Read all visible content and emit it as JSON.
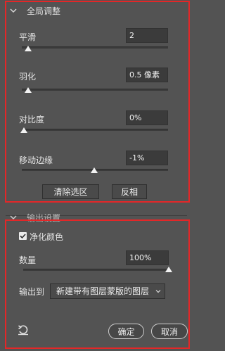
{
  "global_adjust": {
    "title": "全局调整",
    "smooth": {
      "label": "平滑",
      "value": "2",
      "level": 0.03
    },
    "feather": {
      "label": "羽化",
      "value": "0.5 像素",
      "level": 0.03
    },
    "contrast": {
      "label": "对比度",
      "value": "0%",
      "level": 0.0
    },
    "shift_edge": {
      "label": "移动边缘",
      "value": "-1%",
      "level": 0.49
    },
    "clear_selection_label": "清除选区",
    "invert_label": "反相"
  },
  "output": {
    "title": "输出设置",
    "decontaminate_label": "净化颜色",
    "decontaminate_checked": true,
    "amount": {
      "label": "数量",
      "value": "100%",
      "level": 1.0
    },
    "output_to_label": "输出到",
    "output_to_value": "新建带有图层蒙版的图层"
  },
  "footer": {
    "ok_label": "确定",
    "cancel_label": "取消"
  },
  "icons": {
    "collapse": "chevron-down-icon",
    "reset": "reset-icon",
    "check": "checkmark-icon",
    "dropdown": "chevron-down-icon"
  },
  "colors": {
    "panel_bg": "#535353",
    "highlight_frame": "#e32728",
    "field_bg": "#3b3b3b",
    "text": "#e6e6e6"
  }
}
